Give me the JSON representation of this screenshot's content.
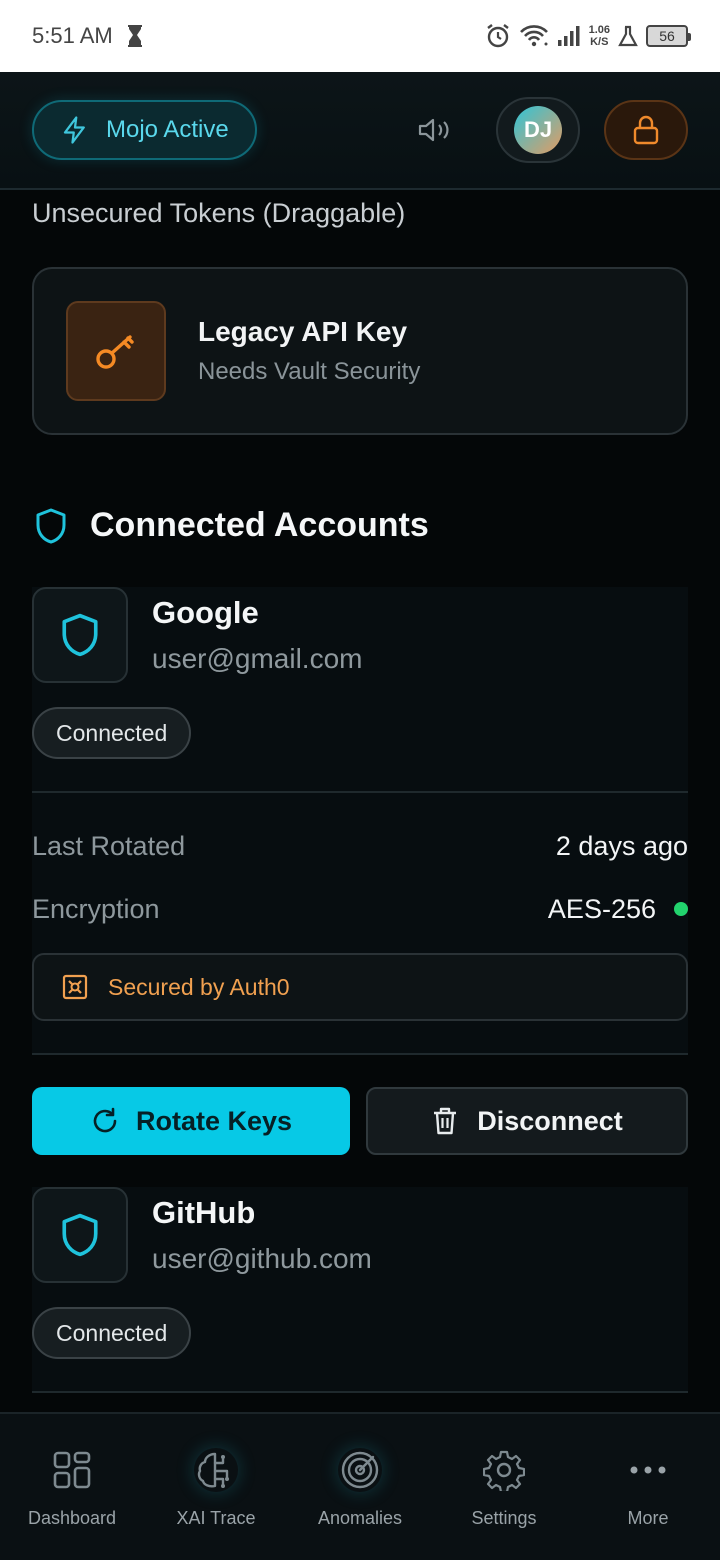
{
  "status_bar": {
    "time": "5:51 AM",
    "net_speed_value": "1.06",
    "net_speed_unit": "K/S",
    "battery": "56"
  },
  "header": {
    "mode_label": "Mojo Active",
    "avatar_initials": "DJ"
  },
  "tokens_section": {
    "title": "Unsecured Tokens (Draggable)",
    "token": {
      "title": "Legacy API Key",
      "subtitle": "Needs Vault Security"
    }
  },
  "accounts_section": {
    "title": "Connected Accounts",
    "accounts": [
      {
        "name": "Google",
        "email": "user@gmail.com",
        "status": "Connected",
        "details": [
          {
            "label": "Last Rotated",
            "value": "2 days ago"
          },
          {
            "label": "Encryption",
            "value": "AES-256"
          }
        ],
        "secured_by": "Secured by Auth0",
        "actions": {
          "rotate": "Rotate Keys",
          "disconnect": "Disconnect"
        }
      },
      {
        "name": "GitHub",
        "email": "user@github.com",
        "status": "Connected"
      }
    ]
  },
  "bottom_nav": [
    {
      "label": "Dashboard",
      "icon": "grid-icon"
    },
    {
      "label": "XAI Trace",
      "icon": "brain-icon"
    },
    {
      "label": "Anomalies",
      "icon": "radar-icon"
    },
    {
      "label": "Settings",
      "icon": "gear-icon"
    },
    {
      "label": "More",
      "icon": "more-icon"
    }
  ],
  "colors": {
    "accent": "#07c9e6",
    "warning": "#f0a050",
    "success": "#22d36d",
    "background": "#040708"
  }
}
